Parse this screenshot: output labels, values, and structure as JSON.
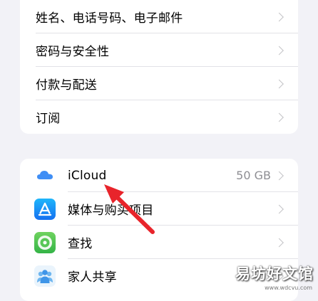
{
  "account_section": {
    "items": [
      {
        "label": "姓名、电话号码、电子邮件"
      },
      {
        "label": "密码与安全性"
      },
      {
        "label": "付款与配送"
      },
      {
        "label": "订阅"
      }
    ]
  },
  "services_section": {
    "items": [
      {
        "label": "iCloud",
        "value": "50 GB",
        "icon": "icloud-icon"
      },
      {
        "label": "媒体与购买项目",
        "icon": "app-store-icon"
      },
      {
        "label": "查找",
        "icon": "find-my-icon"
      },
      {
        "label": "家人共享",
        "icon": "family-sharing-icon"
      }
    ]
  },
  "watermark": {
    "text": "易坊好文馆",
    "url": "www.wdcvu.com"
  },
  "colors": {
    "background": "#f2f2f7",
    "arrow": "#e8242b",
    "chevron": "#c4c4c7"
  }
}
